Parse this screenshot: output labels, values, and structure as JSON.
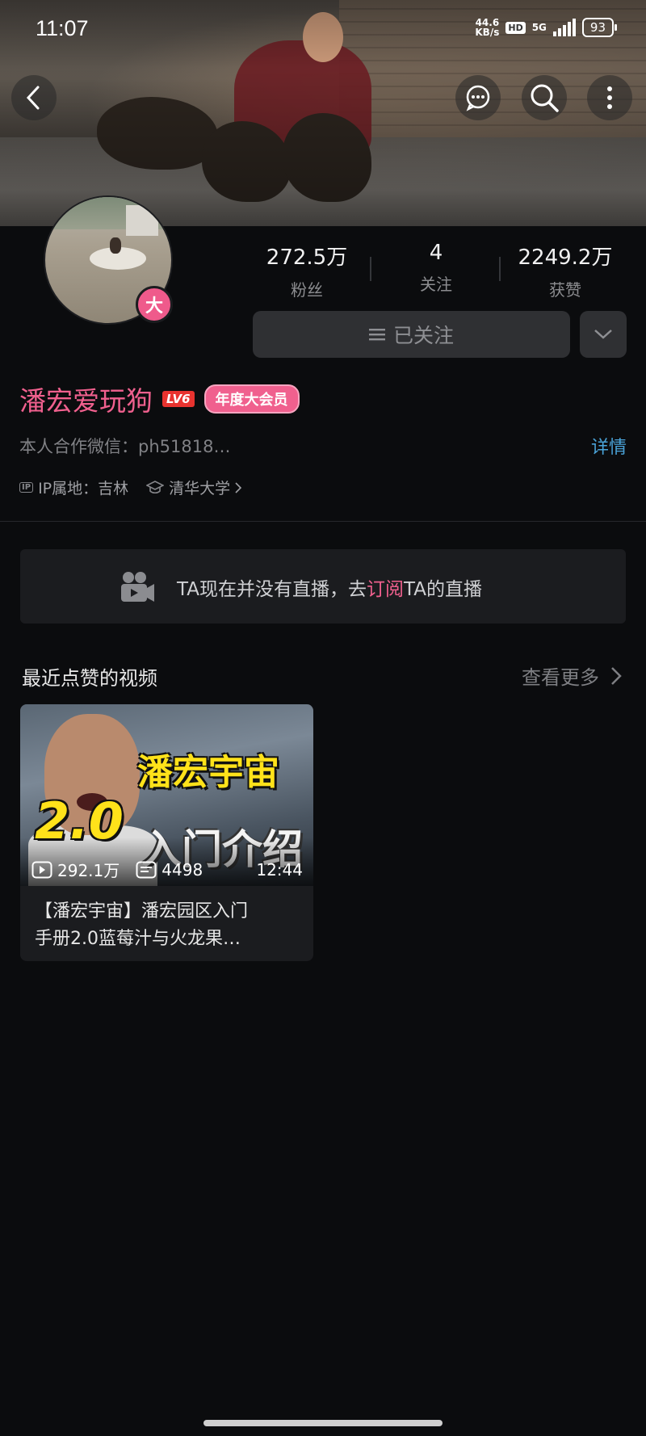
{
  "status_bar": {
    "time": "11:07",
    "net_speed": "44.6",
    "net_unit": "KB/s",
    "hd": "HD",
    "network": "5G",
    "battery": "93"
  },
  "profile": {
    "avatar_badge": "大",
    "name": "潘宏爱玩狗",
    "level": "LV6",
    "vip_tag": "年度大会员",
    "signature": "本人合作微信：ph51818…",
    "detail_link": "详情",
    "ip_location": "IP属地：吉林",
    "school": "清华大学",
    "stats": [
      {
        "value": "272.5万",
        "label": "粉丝"
      },
      {
        "value": "4",
        "label": "关注"
      },
      {
        "value": "2249.2万",
        "label": "获赞"
      }
    ],
    "follow_label": "已关注"
  },
  "live": {
    "prefix": "TA现在并没有直播，去",
    "link": "订阅",
    "suffix": "TA的直播"
  },
  "liked_videos": {
    "title": "最近点赞的视频",
    "more": "查看更多",
    "items": [
      {
        "views": "292.1万",
        "danmaku": "4498",
        "duration": "12:44",
        "title_line1": "【潘宏宇宙】潘宏园区入门",
        "title_line2": "手册2.0蓝莓汁与火龙果…",
        "thumb_text1": "潘宏宇宙",
        "thumb_text2": "2.0",
        "thumb_text3": "入门介绍"
      }
    ]
  },
  "colors": {
    "accent_pink": "#f0608e",
    "link_blue": "#4aa3d8",
    "background": "#0b0c0e"
  }
}
